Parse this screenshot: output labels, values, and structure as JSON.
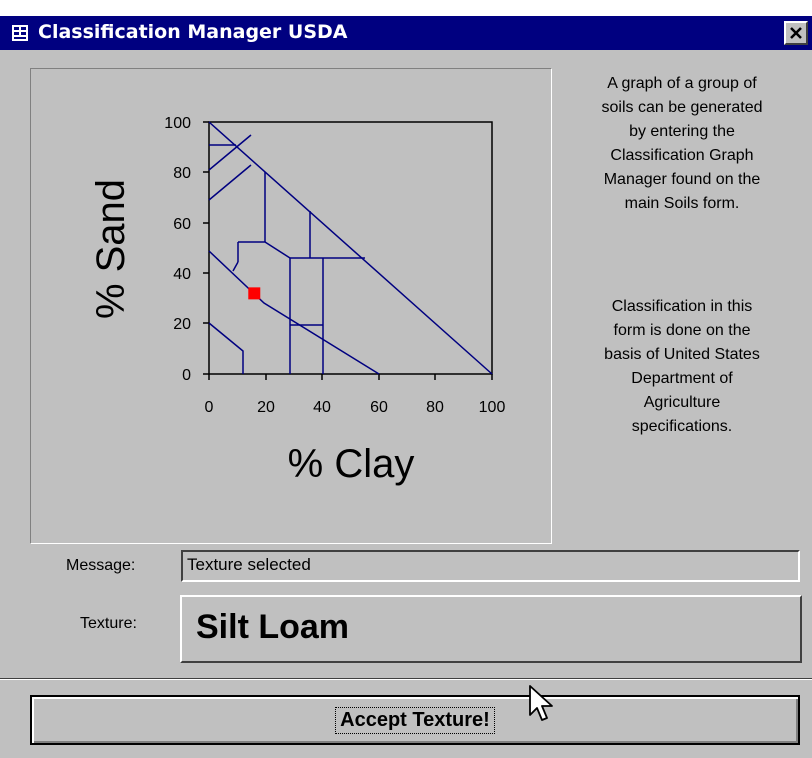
{
  "window": {
    "title": "Classification Manager USDA",
    "close_label": "X"
  },
  "graph": {
    "x_label": "% Clay",
    "y_label": "% Sand",
    "x_ticks": [
      "0",
      "20",
      "40",
      "60",
      "80",
      "100"
    ],
    "y_ticks": [
      "100",
      "80",
      "60",
      "40",
      "20",
      "0"
    ],
    "selected_point": {
      "clay": 16,
      "sand": 32
    },
    "marker_color": "#ff0000",
    "line_color": "#000080"
  },
  "info": {
    "paragraph1": "A graph of a group of\nsoils can be generated\nby entering the\nClassification Graph\nManager found on the\nmain Soils form.",
    "paragraph2": "Classification in this\nform is done on the\nbasis of United States\nDepartment of\nAgriculture\nspecifications."
  },
  "message": {
    "label": "Message:",
    "value": "Texture selected"
  },
  "texture": {
    "label": "Texture:",
    "value": "Silt Loam"
  },
  "accept_button": {
    "label": "Accept Texture!"
  }
}
